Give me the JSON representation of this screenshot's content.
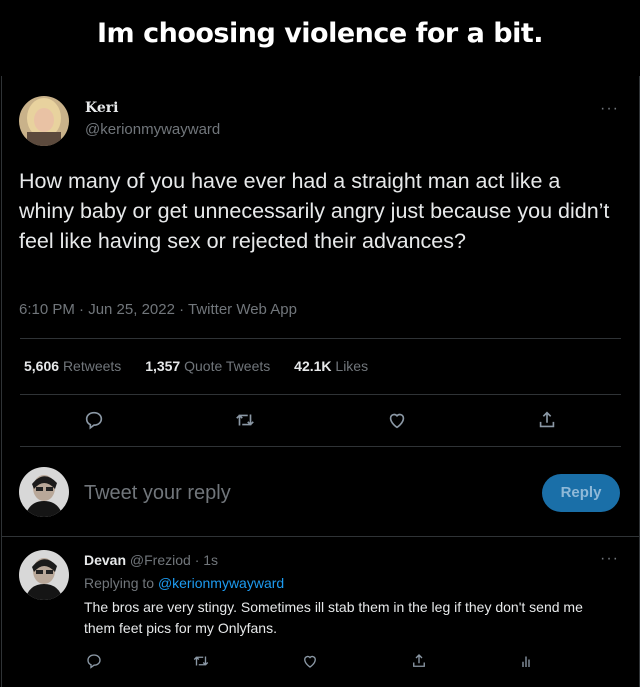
{
  "caption": "Im choosing violence for a bit.",
  "tweet": {
    "display_name": "Keri",
    "handle": "@kerionmywayward",
    "text": "How many of you have ever had a straight man act like a whiny baby or get unnecessarily angry just because you didn’t feel like having sex or rejected their advances?",
    "meta": "6:10 PM · Jun 25, 2022 · Twitter Web App",
    "stats": [
      {
        "value": "5,606",
        "label": "Retweets"
      },
      {
        "value": "1,357",
        "label": "Quote Tweets"
      },
      {
        "value": "42.1K",
        "label": "Likes"
      }
    ],
    "more": "···"
  },
  "composer": {
    "placeholder": "Tweet your reply",
    "reply_button": "Reply"
  },
  "reply": {
    "display_name": "Devan",
    "handle": "@Freziod",
    "time": "· 1s",
    "replying_prefix": "Replying to",
    "replying_handle": "@kerionmywayward",
    "text": "The bros are very stingy. Sometimes ill stab them in the leg if they don't send me them feet pics for my Onlyfans.",
    "more": "···"
  },
  "colors": {
    "background": "#000000",
    "text": "#e7e9ea",
    "muted": "#71767b",
    "accent": "#1d9bf0",
    "reply_button_bg": "#1a6fa8"
  },
  "icons": [
    "comment-icon",
    "retweet-icon",
    "like-icon",
    "share-icon",
    "analytics-icon"
  ]
}
